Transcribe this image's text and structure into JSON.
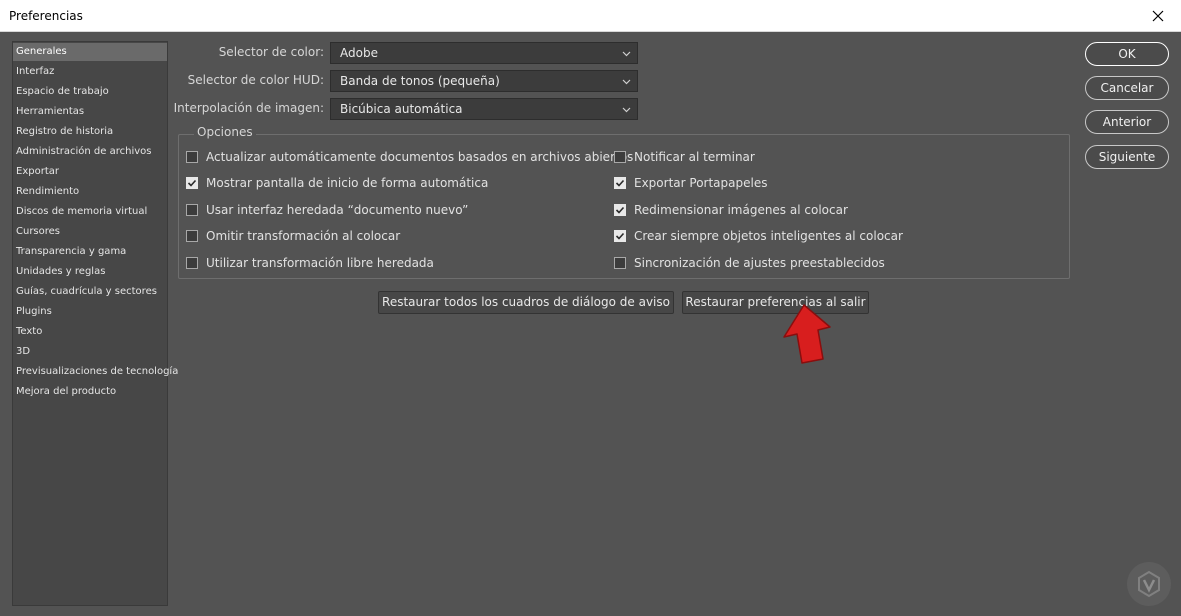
{
  "window": {
    "title": "Preferencias"
  },
  "sidebar": {
    "items": [
      {
        "label": "Generales",
        "active": true
      },
      {
        "label": "Interfaz"
      },
      {
        "label": "Espacio de trabajo"
      },
      {
        "label": "Herramientas"
      },
      {
        "label": "Registro de historia"
      },
      {
        "label": "Administración de archivos"
      },
      {
        "label": "Exportar"
      },
      {
        "label": "Rendimiento"
      },
      {
        "label": "Discos de memoria virtual"
      },
      {
        "label": "Cursores"
      },
      {
        "label": "Transparencia y gama"
      },
      {
        "label": "Unidades y reglas"
      },
      {
        "label": "Guías, cuadrícula y sectores"
      },
      {
        "label": "Plugins"
      },
      {
        "label": "Texto"
      },
      {
        "label": "3D"
      },
      {
        "label": "Previsualizaciones de tecnología"
      },
      {
        "label": "Mejora del producto"
      }
    ]
  },
  "fields": {
    "color_picker": {
      "label": "Selector de color:",
      "value": "Adobe"
    },
    "hud_color_picker": {
      "label": "Selector de color HUD:",
      "value": "Banda de tonos (pequeña)"
    },
    "image_interpolation": {
      "label": "Interpolación de imagen:",
      "value": "Bicúbica automática"
    }
  },
  "options": {
    "title": "Opciones",
    "left": [
      {
        "label": "Actualizar automáticamente documentos basados en archivos abiertos",
        "checked": false
      },
      {
        "label": "Mostrar pantalla de inicio de forma automática",
        "checked": true
      },
      {
        "label": "Usar interfaz heredada “documento nuevo”",
        "checked": false
      },
      {
        "label": "Omitir transformación al colocar",
        "checked": false
      },
      {
        "label": "Utilizar transformación libre heredada",
        "checked": false
      }
    ],
    "right": [
      {
        "label": "Notificar al terminar",
        "checked": false
      },
      {
        "label": "Exportar Portapapeles",
        "checked": true
      },
      {
        "label": "Redimensionar imágenes al colocar",
        "checked": true
      },
      {
        "label": "Crear siempre objetos inteligentes al colocar",
        "checked": true
      },
      {
        "label": "Sincronización de ajustes preestablecidos",
        "checked": false
      }
    ]
  },
  "buttons": {
    "reset_warnings": "Restaurar todos los cuadros de diálogo de aviso",
    "reset_prefs_on_quit": "Restaurar preferencias al salir"
  },
  "dialog_buttons": {
    "ok": "OK",
    "cancel": "Cancelar",
    "previous": "Anterior",
    "next": "Siguiente"
  },
  "colors": {
    "background": "#535353",
    "panel": "#474747",
    "arrow": "#d81e1e"
  },
  "icons": {
    "close": "close-icon",
    "dropdown": "chevron-down-icon",
    "checkmark": "checkmark-icon",
    "pointer_arrow": "arrow-up-icon",
    "watermark": "watermark-logo"
  }
}
